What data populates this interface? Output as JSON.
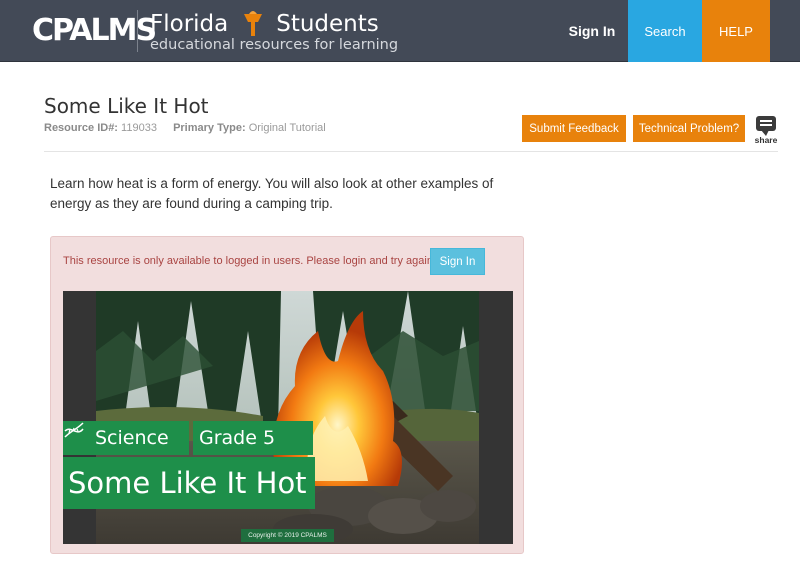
{
  "header": {
    "logo_text": "CPALMS",
    "brand_title_left": "Florida",
    "brand_title_right": "Students",
    "brand_subtitle": "educational resources for learning",
    "nav": {
      "signin": "Sign In",
      "search": "Search",
      "help": "HELP"
    },
    "colors": {
      "bar": "#434a57",
      "search": "#29a7e1",
      "help": "#e8820c"
    }
  },
  "resource": {
    "title": "Some Like It Hot",
    "id_label": "Resource ID#:",
    "id_value": "119033",
    "type_label": "Primary Type:",
    "type_value": "Original Tutorial",
    "buttons": {
      "feedback": "Submit Feedback",
      "technical": "Technical Problem?"
    },
    "share_label": "share",
    "share_icon": "speech-bubble-icon",
    "description": "Learn how heat is a form of energy. You will also look at other examples of energy as they are found during a camping trip."
  },
  "alert": {
    "message": "This resource is only available to logged in users. Please login and try again.",
    "signin_label": "Sign In",
    "colors": {
      "background": "#f2dede",
      "text": "#a94442",
      "button": "#5bc0de"
    }
  },
  "hero": {
    "subject": "Science",
    "grade": "Grade 5",
    "title": "Some Like It Hot",
    "copyright": "Copyright © 2019 CPALMS",
    "tag_color": "#1e8f4a"
  }
}
